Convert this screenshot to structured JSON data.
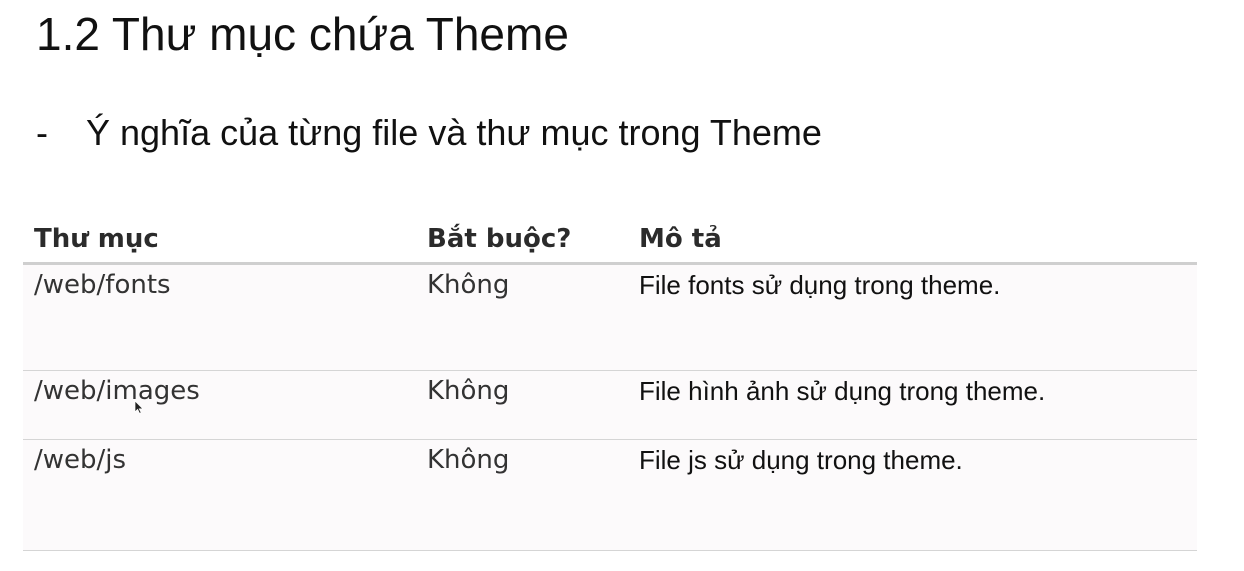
{
  "title": "1.2 Thư mục chứa Theme",
  "bullet": {
    "marker": "-",
    "text": "Ý nghĩa của từng file và thư mục trong Theme"
  },
  "table": {
    "headers": [
      "Thư mục",
      "Bắt buộc?",
      "Mô tả"
    ],
    "rows": [
      [
        "/web/fonts",
        "Không",
        "File fonts sử dụng trong theme."
      ],
      [
        "/web/images",
        "Không",
        "File hình ảnh sử dụng trong theme."
      ],
      [
        "/web/js",
        "Không",
        "File js sử dụng trong theme."
      ]
    ]
  },
  "icons": {
    "cursor": "mouse-pointer-icon"
  }
}
